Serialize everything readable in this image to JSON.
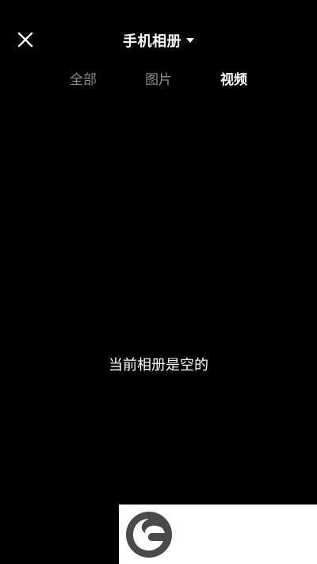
{
  "header": {
    "close_icon": "close-icon",
    "album_title": "手机相册",
    "dropdown_icon": "caret-down-icon"
  },
  "tabs": [
    {
      "label": "全部",
      "active": false
    },
    {
      "label": "图片",
      "active": false
    },
    {
      "label": "视频",
      "active": true
    }
  ],
  "empty_state": {
    "message": "当前相册是空的"
  },
  "watermark": {
    "logo_icon": "leaf-g-logo-icon"
  },
  "colors": {
    "background": "#000000",
    "text_primary": "#ffffff",
    "text_inactive": "#8c8c8c",
    "watermark_bg": "#ffffff",
    "logo": "#4a4a4a"
  }
}
